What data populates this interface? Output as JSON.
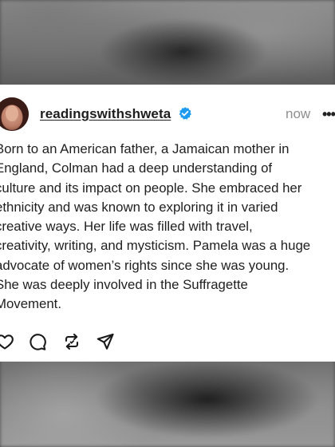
{
  "post": {
    "username": "readingswithshweta",
    "timestamp": "now",
    "more_label": "•••",
    "body": "Born to an American father, a Jamaican mother in\nEngland, Colman had a deep understanding of\nculture and its impact on people. She embraced her\nethnicity and was known to exploring it in varied\ncreative ways. Her life was filled with travel,\ncreativity, writing, and mysticism. Pamela was a huge\nadvocate of women’s rights since she was young.\nShe was deeply involved in the Suffragette\nMovement."
  },
  "icons": {
    "verified": "verified-badge-icon",
    "like": "heart-icon",
    "reply": "comment-icon",
    "repost": "repost-icon",
    "share": "share-icon"
  },
  "colors": {
    "verified": "#1d9bf0",
    "text": "#1f1f1f",
    "muted": "#8e8e8e"
  }
}
